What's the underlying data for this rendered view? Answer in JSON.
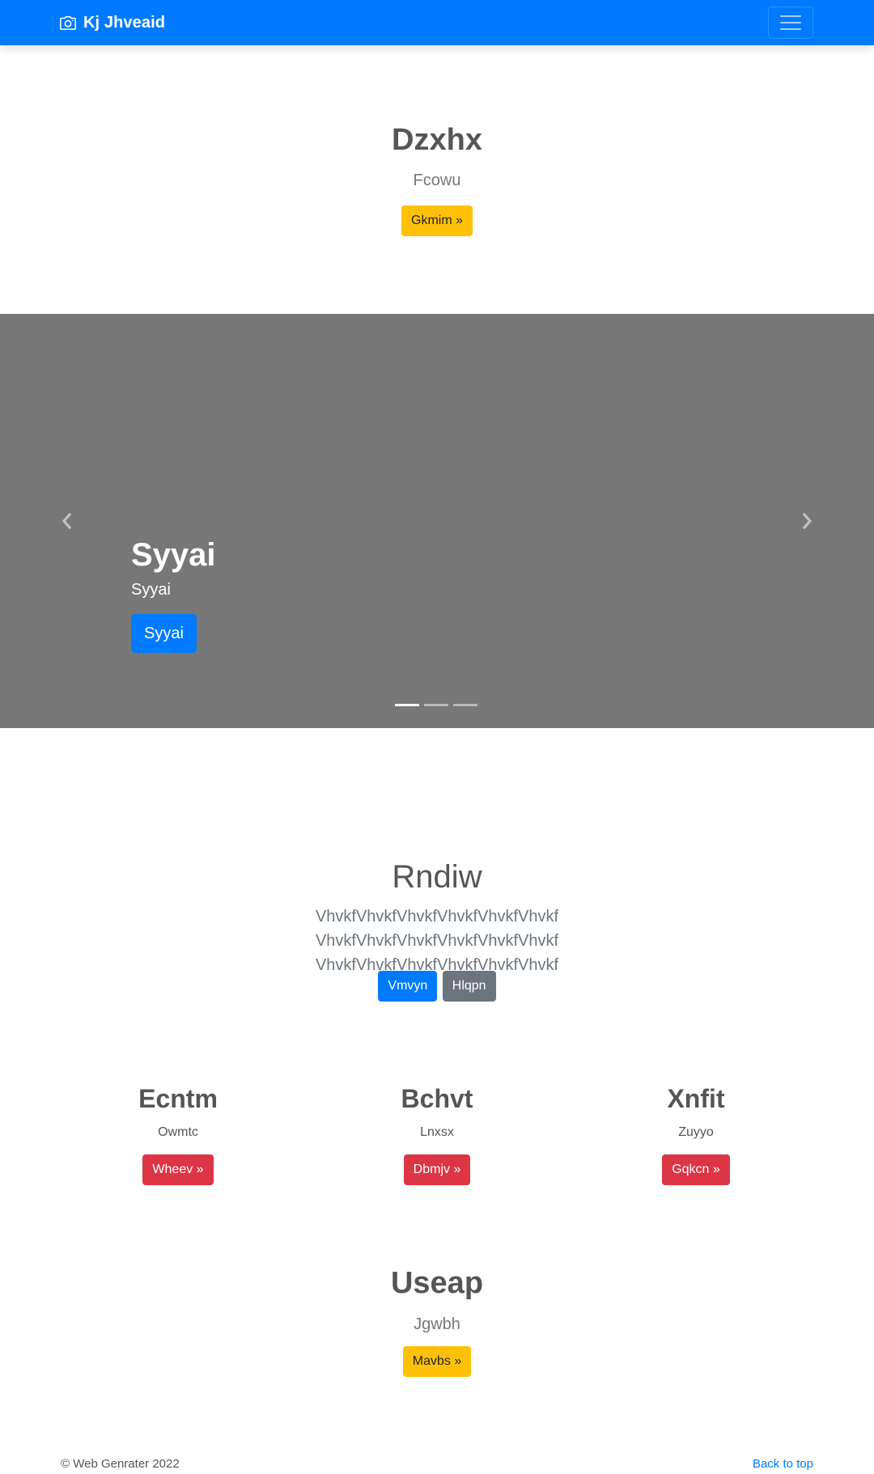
{
  "navbar": {
    "brand": "Kj Jhveaid",
    "brand_icon": "camera-icon",
    "toggler_icon": "hamburger-menu-icon",
    "bg_color": "#007bff"
  },
  "hero": {
    "title": "Dzxhx",
    "subtitle": "Fcowu",
    "button": "Gkmim »"
  },
  "carousel": {
    "bg_color": "#777777",
    "title": "Syyai",
    "text": "Syyai",
    "button": "Syyai",
    "prev_icon": "chevron-left-icon",
    "next_icon": "chevron-right-icon",
    "slide_count": 3,
    "active_slide": 1
  },
  "intro": {
    "title": "Rndiw",
    "lead": "VhvkfVhvkfVhvkfVhvkfVhvkfVhvkf VhvkfVhvkfVhvkfVhvkfVhvkfVhvkf VhvkfVhvkfVhvkfVhvkfVhvkfVhvkf",
    "primary_button": "Vmvyn",
    "secondary_button": "Hlqpn"
  },
  "columns": [
    {
      "title": "Ecntm",
      "text": "Owmtc",
      "button": "Wheev »"
    },
    {
      "title": "Bchvt",
      "text": "Lnxsx",
      "button": "Dbmjv »"
    },
    {
      "title": "Xnfit",
      "text": "Zuyyo",
      "button": "Gqkcn »"
    }
  ],
  "bottom": {
    "title": "Useap",
    "subtitle": "Jgwbh",
    "button": "Mavbs »"
  },
  "footer": {
    "copyright": "© Web Genrater 2022",
    "back_to_top": "Back to top"
  }
}
